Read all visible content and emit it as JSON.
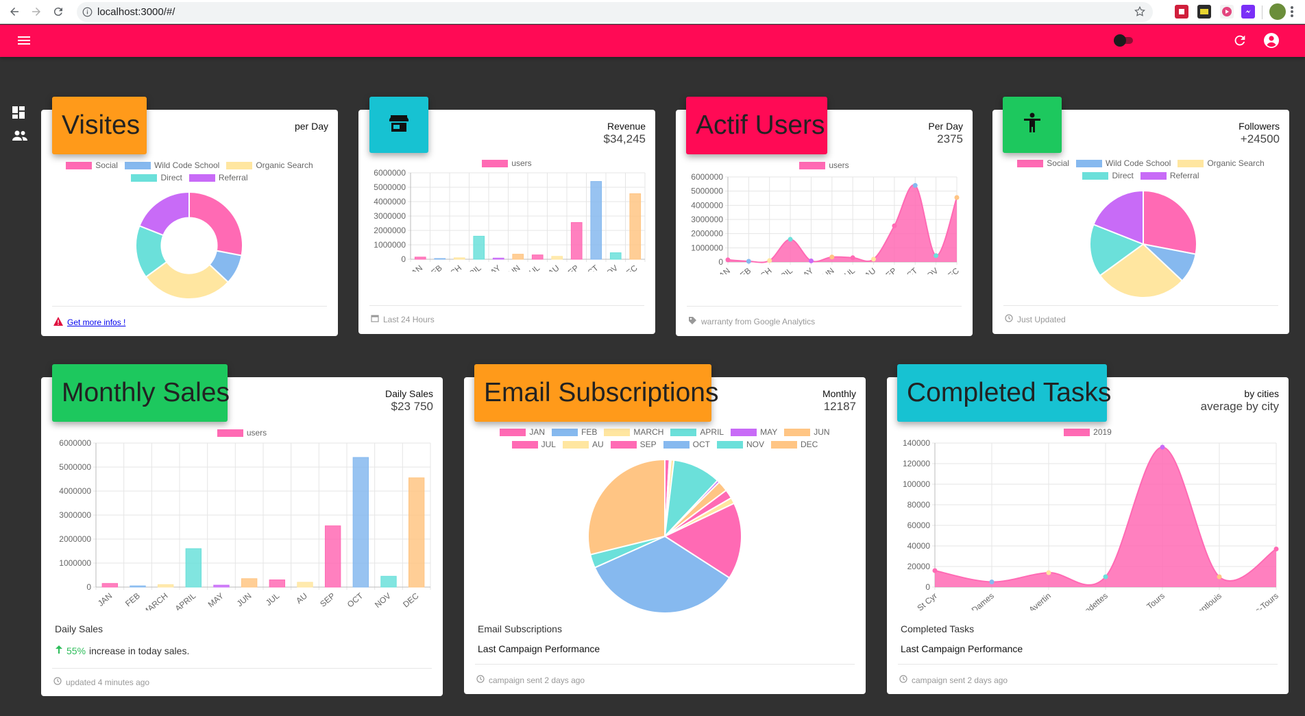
{
  "browser": {
    "url": "localhost:3000/#/",
    "extensions": [
      "pdf-ext-icon",
      "notes-ext-icon",
      "media-ext-icon",
      "messenger-ext-icon"
    ]
  },
  "colors": {
    "appbar": "#ff0a55",
    "background": "#313131",
    "pink": "#ff6ab4",
    "blue": "#86b9ef",
    "yellow": "#ffe6a0",
    "teal": "#6be0da",
    "purple": "#c86bf7",
    "peach": "#ffc584",
    "tab_orange": "#ff9a1a",
    "tab_cyan": "#17c2d2",
    "tab_red": "#ff0a55",
    "tab_green": "#1dc85e",
    "increase_green": "#2dbd5a",
    "warn_red": "#e0103e"
  },
  "cards": {
    "visites": {
      "title": "Visites",
      "head_a": "per Day",
      "head_b": "",
      "footer_link": "Get more infos !",
      "legend": [
        "Social",
        "Wild Code School",
        "Organic Search",
        "Direct",
        "Referral"
      ]
    },
    "revenue": {
      "head_a": "Revenue",
      "head_b": "$34,245",
      "footer": "Last 24 Hours",
      "legend": [
        "users"
      ]
    },
    "actif": {
      "title": "Actif Users",
      "head_a": "Per Day",
      "head_b": "2375",
      "footer": "warranty from Google Analytics",
      "legend": [
        "users"
      ]
    },
    "followers": {
      "head_a": "Followers",
      "head_b": "+24500",
      "footer": "Just Updated",
      "legend": [
        "Social",
        "Wild Code School",
        "Organic Search",
        "Direct",
        "Referral"
      ]
    },
    "monthly": {
      "title": "Monthly Sales",
      "head_a": "Daily Sales",
      "head_b": "$23 750",
      "legend": [
        "users"
      ],
      "daily_label": "Daily Sales",
      "increase_pct": "55%",
      "increase_text": "increase in today sales.",
      "footer": "updated 4 minutes ago"
    },
    "email": {
      "title": "Email Subscriptions",
      "head_a": "Monthly",
      "head_b": "12187",
      "legend": [
        "JAN",
        "FEB",
        "MARCH",
        "APRIL",
        "MAY",
        "JUN",
        "JUL",
        "AU",
        "SEP",
        "OCT",
        "NOV",
        "DEC"
      ],
      "line1": "Email Subscriptions",
      "line2": "Last Campaign Performance",
      "footer": "campaign sent 2 days ago"
    },
    "tasks": {
      "title": "Completed Tasks",
      "head_a": "by cities",
      "head_b": "average by city",
      "legend": [
        "2019"
      ],
      "line1": "Completed Tasks",
      "line2": "Last Campaign Performance",
      "footer": "campaign sent 2 days ago"
    }
  },
  "chart_data": [
    {
      "id": "visites",
      "type": "pie",
      "donut": true,
      "labels": [
        "Social",
        "Wild Code School",
        "Organic Search",
        "Direct",
        "Referral"
      ],
      "values": [
        28,
        9,
        28,
        16,
        19
      ]
    },
    {
      "id": "revenue",
      "type": "bar",
      "categories": [
        "JAN",
        "FEB",
        "MARCH",
        "APRIL",
        "MAY",
        "JUN",
        "JUL",
        "AU",
        "SEP",
        "OCT",
        "NOV",
        "DEC"
      ],
      "values": [
        150000,
        50000,
        100000,
        1600000,
        80000,
        350000,
        300000,
        200000,
        2550000,
        5400000,
        450000,
        4550000
      ],
      "ylim": [
        0,
        6000000
      ],
      "yticks": [
        0,
        1000000,
        2000000,
        3000000,
        4000000,
        5000000,
        6000000
      ],
      "series_name": "users"
    },
    {
      "id": "actif",
      "type": "area",
      "categories": [
        "JAN",
        "FEB",
        "MARCH",
        "APRIL",
        "MAY",
        "JUN",
        "JUL",
        "AU",
        "SEP",
        "OCT",
        "NOV",
        "DEC"
      ],
      "values": [
        150000,
        50000,
        100000,
        1600000,
        80000,
        350000,
        300000,
        200000,
        2550000,
        5400000,
        450000,
        4550000
      ],
      "ylim": [
        0,
        6000000
      ],
      "yticks": [
        0,
        1000000,
        2000000,
        3000000,
        4000000,
        5000000,
        6000000
      ],
      "series_name": "users"
    },
    {
      "id": "followers",
      "type": "pie",
      "labels": [
        "Social",
        "Wild Code School",
        "Organic Search",
        "Direct",
        "Referral"
      ],
      "values": [
        28,
        9,
        28,
        16,
        19
      ]
    },
    {
      "id": "monthly",
      "type": "bar",
      "categories": [
        "JAN",
        "FEB",
        "MARCH",
        "APRIL",
        "MAY",
        "JUN",
        "JUL",
        "AU",
        "SEP",
        "OCT",
        "NOV",
        "DEC"
      ],
      "values": [
        150000,
        50000,
        100000,
        1600000,
        80000,
        350000,
        300000,
        200000,
        2550000,
        5400000,
        450000,
        4550000
      ],
      "ylim": [
        0,
        6000000
      ],
      "yticks": [
        0,
        1000000,
        2000000,
        3000000,
        4000000,
        5000000,
        6000000
      ],
      "series_name": "users"
    },
    {
      "id": "email",
      "type": "pie",
      "labels": [
        "JAN",
        "FEB",
        "MARCH",
        "APRIL",
        "MAY",
        "JUN",
        "JUL",
        "AU",
        "SEP",
        "OCT",
        "NOV",
        "DEC"
      ],
      "values": [
        150000,
        50000,
        100000,
        1600000,
        80000,
        350000,
        300000,
        200000,
        2550000,
        5400000,
        450000,
        4550000
      ]
    },
    {
      "id": "tasks",
      "type": "area",
      "categories": [
        "St Cyr",
        "La Ville Aux Dames",
        "St Avertin",
        "Fondettes",
        "Tours",
        "Montlouis",
        "Joué-lès-Tours"
      ],
      "values": [
        16000,
        5000,
        14000,
        10000,
        136000,
        10000,
        37000
      ],
      "ylim": [
        0,
        140000
      ],
      "yticks": [
        0,
        20000,
        40000,
        60000,
        80000,
        100000,
        120000,
        140000
      ],
      "series_name": "2019"
    }
  ]
}
